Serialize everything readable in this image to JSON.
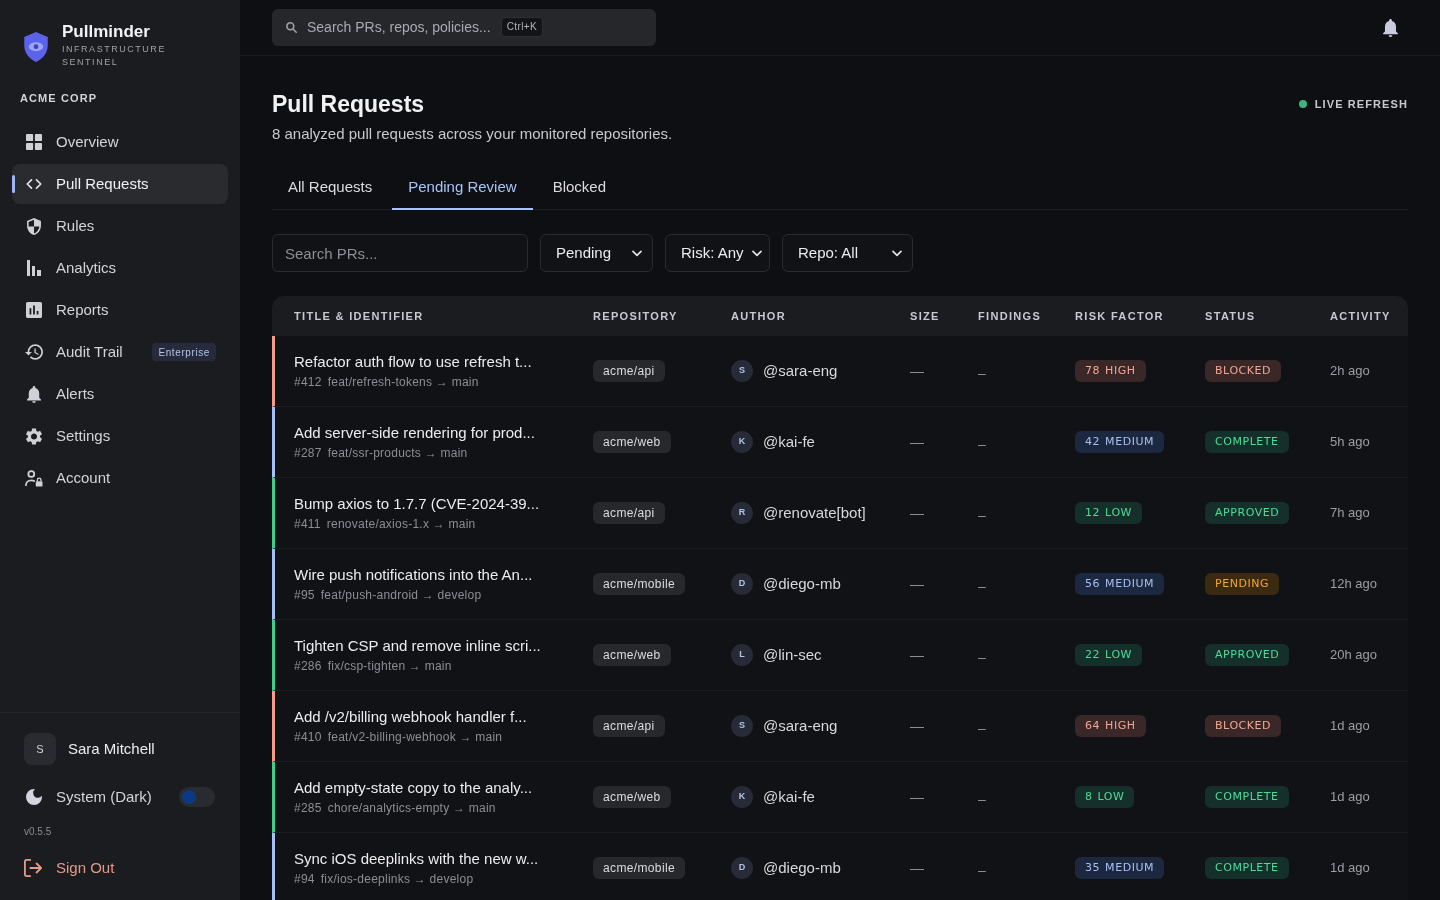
{
  "sidebar": {
    "brand": {
      "name": "Pullminder",
      "tagline": "INFRASTRUCTURE SENTINEL"
    },
    "org": "ACME CORP",
    "nav": [
      {
        "label": "Overview",
        "selected": false
      },
      {
        "label": "Pull Requests",
        "selected": true
      },
      {
        "label": "Rules",
        "selected": false
      },
      {
        "label": "Analytics",
        "selected": false
      },
      {
        "label": "Reports",
        "selected": false
      },
      {
        "label": "Audit Trail",
        "selected": false,
        "badge": "Enterprise"
      },
      {
        "label": "Alerts",
        "selected": false
      },
      {
        "label": "Settings",
        "selected": false
      },
      {
        "label": "Account",
        "selected": false
      }
    ],
    "user": {
      "initial": "S",
      "name": "Sara Mitchell"
    },
    "theme": {
      "label": "System (Dark)",
      "on": false
    },
    "version": "v0.5.5",
    "sign_out": "Sign Out"
  },
  "topbar": {
    "search": {
      "placeholder": "Search PRs, repos, policies...",
      "shortcut": "Ctrl+K"
    }
  },
  "header": {
    "title": "Pull Requests",
    "subtitle": "8 analyzed pull requests across your monitored repositories.",
    "live": "LIVE REFRESH"
  },
  "tabs": [
    {
      "label": "All Requests",
      "selected": false
    },
    {
      "label": "Pending Review",
      "selected": true
    },
    {
      "label": "Blocked",
      "selected": false
    }
  ],
  "filters": {
    "search": {
      "placeholder": "Search PRs..."
    },
    "dropdowns": [
      {
        "value": "Pending"
      },
      {
        "value": "Risk: Any"
      },
      {
        "value": "Repo: All"
      }
    ]
  },
  "table": {
    "columns": [
      "TITLE & IDENTIFIER",
      "REPOSITORY",
      "AUTHOR",
      "SIZE",
      "FINDINGS",
      "RISK FACTOR",
      "STATUS",
      "ACTIVITY"
    ],
    "rows": [
      {
        "title": "Refactor auth flow to use refresh t...",
        "number": "#412",
        "branch": "feat/refresh-tokens → main",
        "repo": "acme/api",
        "author_initial": "S",
        "author": "@sara-eng",
        "size": "—",
        "findings": "–",
        "risk": {
          "score": "78",
          "label": "HIGH",
          "kind": "high"
        },
        "status": {
          "label": "BLOCKED",
          "kind": "blocked"
        },
        "activity": "2h ago"
      },
      {
        "title": "Add server-side rendering for prod...",
        "number": "#287",
        "branch": "feat/ssr-products → main",
        "repo": "acme/web",
        "author_initial": "K",
        "author": "@kai-fe",
        "size": "—",
        "findings": "–",
        "risk": {
          "score": "42",
          "label": "MEDIUM",
          "kind": "medium"
        },
        "status": {
          "label": "COMPLETE",
          "kind": "complete"
        },
        "activity": "5h ago"
      },
      {
        "title": "Bump axios to 1.7.7 (CVE-2024-39...",
        "number": "#411",
        "branch": "renovate/axios-1.x → main",
        "repo": "acme/api",
        "author_initial": "R",
        "author": "@renovate[bot]",
        "size": "—",
        "findings": "–",
        "risk": {
          "score": "12",
          "label": "LOW",
          "kind": "low"
        },
        "status": {
          "label": "APPROVED",
          "kind": "approved"
        },
        "activity": "7h ago"
      },
      {
        "title": "Wire push notifications into the An...",
        "number": "#95",
        "branch": "feat/push-android → develop",
        "repo": "acme/mobile",
        "author_initial": "D",
        "author": "@diego-mb",
        "size": "—",
        "findings": "–",
        "risk": {
          "score": "56",
          "label": "MEDIUM",
          "kind": "medium"
        },
        "status": {
          "label": "PENDING",
          "kind": "pending"
        },
        "activity": "12h ago"
      },
      {
        "title": "Tighten CSP and remove inline scri...",
        "number": "#286",
        "branch": "fix/csp-tighten → main",
        "repo": "acme/web",
        "author_initial": "L",
        "author": "@lin-sec",
        "size": "—",
        "findings": "–",
        "risk": {
          "score": "22",
          "label": "LOW",
          "kind": "low"
        },
        "status": {
          "label": "APPROVED",
          "kind": "approved"
        },
        "activity": "20h ago"
      },
      {
        "title": "Add /v2/billing webhook handler f...",
        "number": "#410",
        "branch": "feat/v2-billing-webhook → main",
        "repo": "acme/api",
        "author_initial": "S",
        "author": "@sara-eng",
        "size": "—",
        "findings": "–",
        "risk": {
          "score": "64",
          "label": "HIGH",
          "kind": "high"
        },
        "status": {
          "label": "BLOCKED",
          "kind": "blocked"
        },
        "activity": "1d ago"
      },
      {
        "title": "Add empty-state copy to the analy...",
        "number": "#285",
        "branch": "chore/analytics-empty → main",
        "repo": "acme/web",
        "author_initial": "K",
        "author": "@kai-fe",
        "size": "—",
        "findings": "–",
        "risk": {
          "score": "8",
          "label": "LOW",
          "kind": "low"
        },
        "status": {
          "label": "COMPLETE",
          "kind": "complete"
        },
        "activity": "1d ago"
      },
      {
        "title": "Sync iOS deeplinks with the new w...",
        "number": "#94",
        "branch": "fix/ios-deeplinks → develop",
        "repo": "acme/mobile",
        "author_initial": "D",
        "author": "@diego-mb",
        "size": "—",
        "findings": "–",
        "risk": {
          "score": "35",
          "label": "MEDIUM",
          "kind": "medium"
        },
        "status": {
          "label": "COMPLETE",
          "kind": "complete"
        },
        "activity": "1d ago"
      }
    ]
  }
}
